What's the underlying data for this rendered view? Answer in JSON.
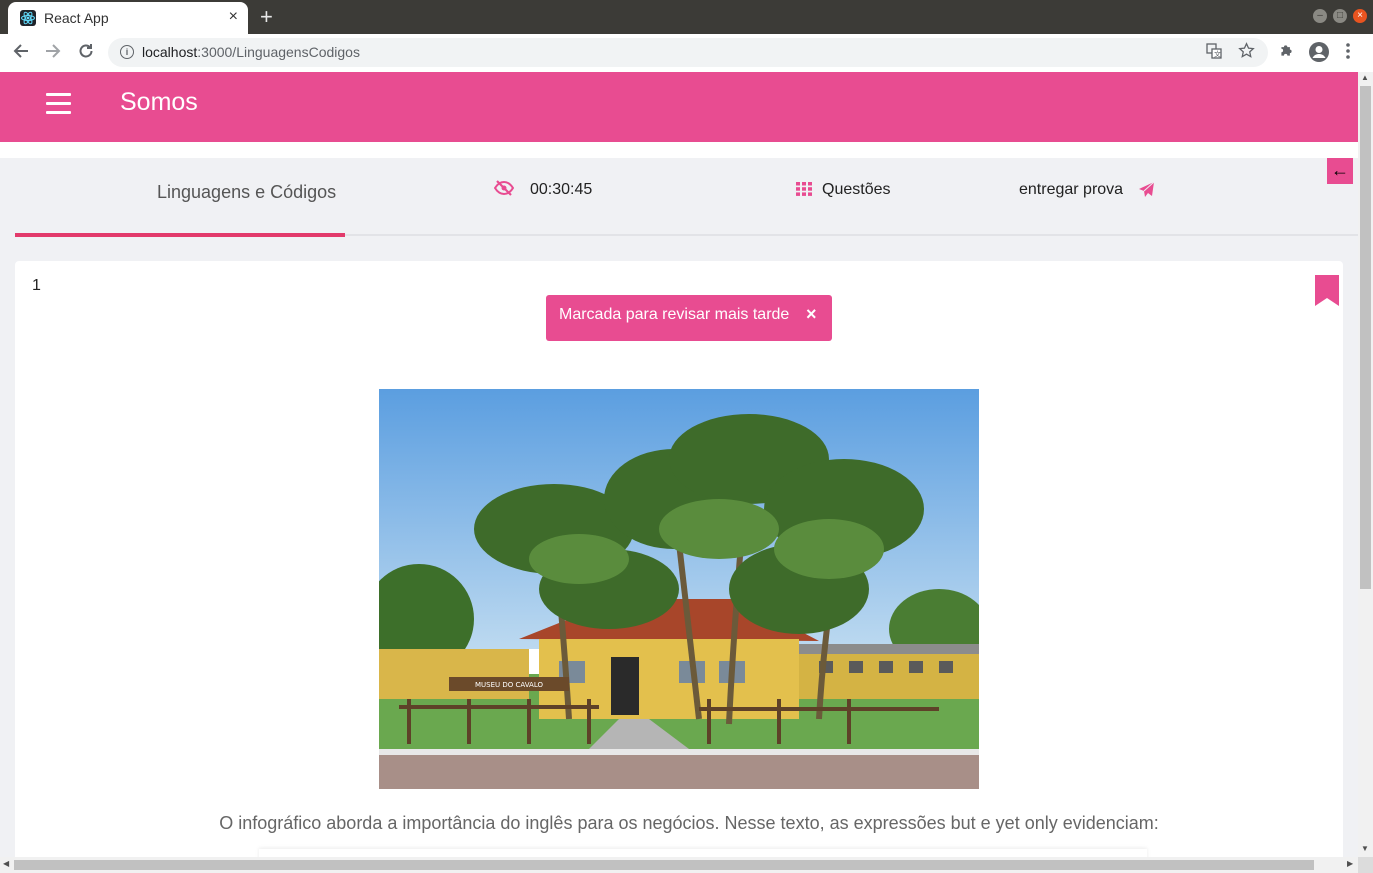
{
  "browser": {
    "tab_title": "React App",
    "tab_close": "×",
    "new_tab": "+",
    "url_host": "localhost",
    "url_path": ":3000/LinguagensCodigos",
    "info": "i"
  },
  "app": {
    "brand": "Somos",
    "subject_tab": "Linguagens e Códigos",
    "timer": "00:30:45",
    "questions_label": "Questões",
    "submit_label": "entregar prova",
    "back_arrow": "←",
    "accent_color": "#e84c91"
  },
  "question": {
    "number": "1",
    "toast_text": "Marcada para revisar mais tarde",
    "toast_close": "×",
    "text": "O infográfico aborda a importância do inglês para os negócios. Nesse texto, as expressões but e yet only evidenciam:",
    "photo_sign": "MUSEU DO CAVALO"
  }
}
